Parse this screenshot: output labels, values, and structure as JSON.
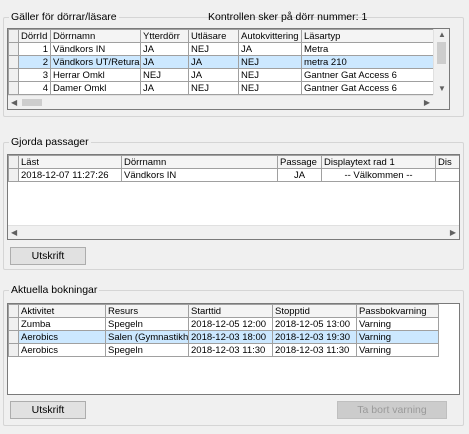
{
  "doors": {
    "title": "Gäller för dörrar/läsare",
    "note": "Kontrollen sker på dörr nummer: 1",
    "columns": [
      "DörrId",
      "Dörrnamn",
      "Ytterdörr",
      "Utläsare",
      "Autokvittering",
      "Läsartyp"
    ],
    "rows": [
      [
        "1",
        "Vändkors IN",
        "JA",
        "NEJ",
        "JA",
        "Metra"
      ],
      [
        "2",
        "Vändkors UT/Returautom",
        "JA",
        "JA",
        "NEJ",
        "metra 210"
      ],
      [
        "3",
        "Herrar Omkl",
        "NEJ",
        "JA",
        "NEJ",
        "Gantner Gat Access 6"
      ],
      [
        "4",
        "Damer Omkl",
        "JA",
        "NEJ",
        "NEJ",
        "Gantner Gat Access 6"
      ]
    ],
    "selected_row": 1
  },
  "passages": {
    "title": "Gjorda passager",
    "columns": [
      "Läst",
      "Dörrnamn",
      "Passage",
      "Displaytext rad 1",
      "Dis"
    ],
    "rows": [
      [
        "2018-12-07 11:27:26",
        "Vändkors IN",
        "JA",
        "-- Välkommen --",
        ""
      ]
    ],
    "print_label": "Utskrift"
  },
  "bookings": {
    "title": "Aktuella bokningar",
    "columns": [
      "Aktivitet",
      "Resurs",
      "Starttid",
      "Stopptid",
      "Passbokvarning"
    ],
    "rows": [
      [
        "Zumba",
        "Spegeln",
        "2018-12-05 12:00",
        "2018-12-05 13:00",
        "Varning"
      ],
      [
        "Aerobics",
        "Salen (Gymnastikh",
        "2018-12-03 18:00",
        "2018-12-03 19:30",
        "Varning"
      ],
      [
        "Aerobics",
        "Spegeln",
        "2018-12-03 11:30",
        "2018-12-03 11:30",
        "Varning"
      ]
    ],
    "selected_row": 1,
    "print_label": "Utskrift",
    "remove_label": "Ta bort varning"
  }
}
